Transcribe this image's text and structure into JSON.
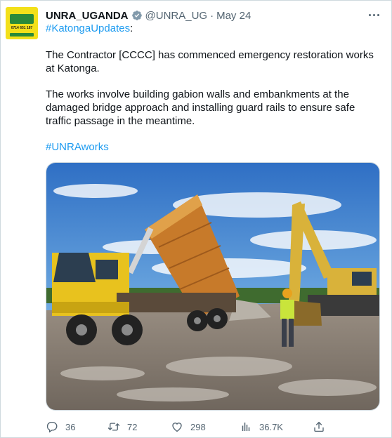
{
  "tweet": {
    "avatar": {
      "alt_text": "0714 651 187",
      "brand": "UNRA"
    },
    "display_name": "UNRA_UGANDA",
    "verified_icon": "verified-badge-icon",
    "handle": "@UNRA_UG",
    "separator": "·",
    "date": "May 24",
    "hashtag_line": {
      "tag": "#KatongaUpdates",
      "suffix": ":"
    },
    "paragraph1": "The Contractor [CCCC] has commenced emergency restoration works at Katonga.",
    "paragraph2": "The works involve building gabion walls and embankments at  the damaged bridge approach and installing guard rails to ensure safe traffic passage in the meantime.",
    "hashtag2": "#UNRAworks",
    "media": {
      "description_icon": "photo-truck-excavator"
    },
    "actions": {
      "reply_count": "36",
      "retweet_count": "72",
      "like_count": "298",
      "view_count": "36.7K"
    }
  },
  "colors": {
    "link": "#1d9bf0",
    "secondary_text": "#536471",
    "avatar_bg": "#f3e01a",
    "avatar_band": "#2a8a3a",
    "verified": "#829aab"
  }
}
